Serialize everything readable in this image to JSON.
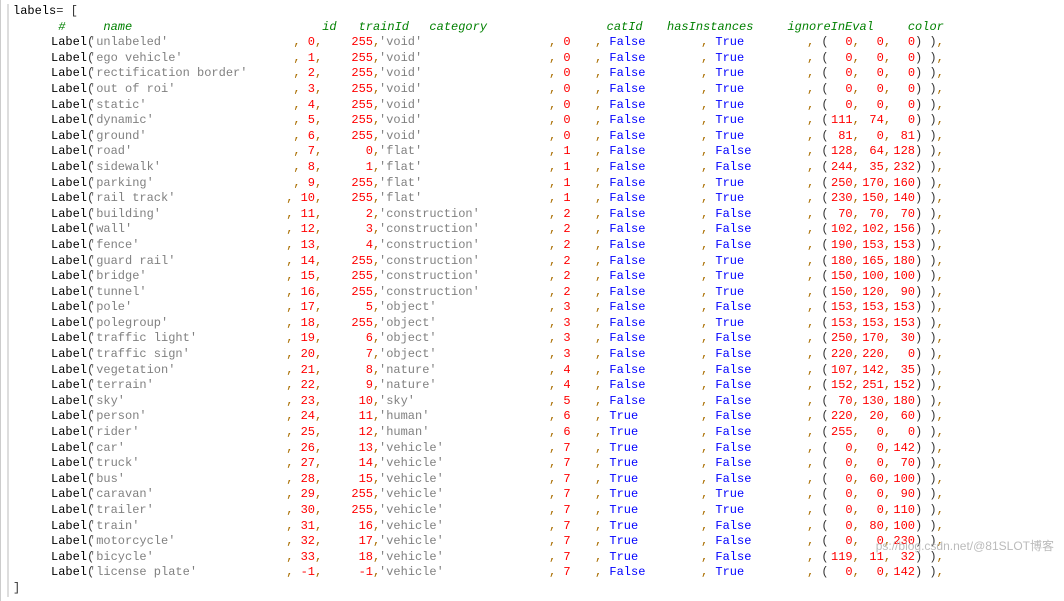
{
  "varName": "labels",
  "header": {
    "hash": "#",
    "name": "name",
    "id": "id",
    "trainId": "trainId",
    "category": "category",
    "catId": "catId",
    "hasInstances": "hasInstances",
    "ignoreInEval": "ignoreInEval",
    "color": "color"
  },
  "funcName": "Label",
  "rows": [
    {
      "name": "unlabeled",
      "id": 0,
      "trainId": 255,
      "category": "void",
      "catId": 0,
      "hasInstances": "False",
      "ignoreInEval": "True",
      "color": [
        0,
        0,
        0
      ]
    },
    {
      "name": "ego vehicle",
      "id": 1,
      "trainId": 255,
      "category": "void",
      "catId": 0,
      "hasInstances": "False",
      "ignoreInEval": "True",
      "color": [
        0,
        0,
        0
      ]
    },
    {
      "name": "rectification border",
      "id": 2,
      "trainId": 255,
      "category": "void",
      "catId": 0,
      "hasInstances": "False",
      "ignoreInEval": "True",
      "color": [
        0,
        0,
        0
      ]
    },
    {
      "name": "out of roi",
      "id": 3,
      "trainId": 255,
      "category": "void",
      "catId": 0,
      "hasInstances": "False",
      "ignoreInEval": "True",
      "color": [
        0,
        0,
        0
      ]
    },
    {
      "name": "static",
      "id": 4,
      "trainId": 255,
      "category": "void",
      "catId": 0,
      "hasInstances": "False",
      "ignoreInEval": "True",
      "color": [
        0,
        0,
        0
      ]
    },
    {
      "name": "dynamic",
      "id": 5,
      "trainId": 255,
      "category": "void",
      "catId": 0,
      "hasInstances": "False",
      "ignoreInEval": "True",
      "color": [
        111,
        74,
        0
      ]
    },
    {
      "name": "ground",
      "id": 6,
      "trainId": 255,
      "category": "void",
      "catId": 0,
      "hasInstances": "False",
      "ignoreInEval": "True",
      "color": [
        81,
        0,
        81
      ]
    },
    {
      "name": "road",
      "id": 7,
      "trainId": 0,
      "category": "flat",
      "catId": 1,
      "hasInstances": "False",
      "ignoreInEval": "False",
      "color": [
        128,
        64,
        128
      ]
    },
    {
      "name": "sidewalk",
      "id": 8,
      "trainId": 1,
      "category": "flat",
      "catId": 1,
      "hasInstances": "False",
      "ignoreInEval": "False",
      "color": [
        244,
        35,
        232
      ]
    },
    {
      "name": "parking",
      "id": 9,
      "trainId": 255,
      "category": "flat",
      "catId": 1,
      "hasInstances": "False",
      "ignoreInEval": "True",
      "color": [
        250,
        170,
        160
      ]
    },
    {
      "name": "rail track",
      "id": 10,
      "trainId": 255,
      "category": "flat",
      "catId": 1,
      "hasInstances": "False",
      "ignoreInEval": "True",
      "color": [
        230,
        150,
        140
      ]
    },
    {
      "name": "building",
      "id": 11,
      "trainId": 2,
      "category": "construction",
      "catId": 2,
      "hasInstances": "False",
      "ignoreInEval": "False",
      "color": [
        70,
        70,
        70
      ]
    },
    {
      "name": "wall",
      "id": 12,
      "trainId": 3,
      "category": "construction",
      "catId": 2,
      "hasInstances": "False",
      "ignoreInEval": "False",
      "color": [
        102,
        102,
        156
      ]
    },
    {
      "name": "fence",
      "id": 13,
      "trainId": 4,
      "category": "construction",
      "catId": 2,
      "hasInstances": "False",
      "ignoreInEval": "False",
      "color": [
        190,
        153,
        153
      ]
    },
    {
      "name": "guard rail",
      "id": 14,
      "trainId": 255,
      "category": "construction",
      "catId": 2,
      "hasInstances": "False",
      "ignoreInEval": "True",
      "color": [
        180,
        165,
        180
      ]
    },
    {
      "name": "bridge",
      "id": 15,
      "trainId": 255,
      "category": "construction",
      "catId": 2,
      "hasInstances": "False",
      "ignoreInEval": "True",
      "color": [
        150,
        100,
        100
      ]
    },
    {
      "name": "tunnel",
      "id": 16,
      "trainId": 255,
      "category": "construction",
      "catId": 2,
      "hasInstances": "False",
      "ignoreInEval": "True",
      "color": [
        150,
        120,
        90
      ]
    },
    {
      "name": "pole",
      "id": 17,
      "trainId": 5,
      "category": "object",
      "catId": 3,
      "hasInstances": "False",
      "ignoreInEval": "False",
      "color": [
        153,
        153,
        153
      ]
    },
    {
      "name": "polegroup",
      "id": 18,
      "trainId": 255,
      "category": "object",
      "catId": 3,
      "hasInstances": "False",
      "ignoreInEval": "True",
      "color": [
        153,
        153,
        153
      ]
    },
    {
      "name": "traffic light",
      "id": 19,
      "trainId": 6,
      "category": "object",
      "catId": 3,
      "hasInstances": "False",
      "ignoreInEval": "False",
      "color": [
        250,
        170,
        30
      ]
    },
    {
      "name": "traffic sign",
      "id": 20,
      "trainId": 7,
      "category": "object",
      "catId": 3,
      "hasInstances": "False",
      "ignoreInEval": "False",
      "color": [
        220,
        220,
        0
      ]
    },
    {
      "name": "vegetation",
      "id": 21,
      "trainId": 8,
      "category": "nature",
      "catId": 4,
      "hasInstances": "False",
      "ignoreInEval": "False",
      "color": [
        107,
        142,
        35
      ]
    },
    {
      "name": "terrain",
      "id": 22,
      "trainId": 9,
      "category": "nature",
      "catId": 4,
      "hasInstances": "False",
      "ignoreInEval": "False",
      "color": [
        152,
        251,
        152
      ]
    },
    {
      "name": "sky",
      "id": 23,
      "trainId": 10,
      "category": "sky",
      "catId": 5,
      "hasInstances": "False",
      "ignoreInEval": "False",
      "color": [
        70,
        130,
        180
      ]
    },
    {
      "name": "person",
      "id": 24,
      "trainId": 11,
      "category": "human",
      "catId": 6,
      "hasInstances": "True",
      "ignoreInEval": "False",
      "color": [
        220,
        20,
        60
      ]
    },
    {
      "name": "rider",
      "id": 25,
      "trainId": 12,
      "category": "human",
      "catId": 6,
      "hasInstances": "True",
      "ignoreInEval": "False",
      "color": [
        255,
        0,
        0
      ]
    },
    {
      "name": "car",
      "id": 26,
      "trainId": 13,
      "category": "vehicle",
      "catId": 7,
      "hasInstances": "True",
      "ignoreInEval": "False",
      "color": [
        0,
        0,
        142
      ]
    },
    {
      "name": "truck",
      "id": 27,
      "trainId": 14,
      "category": "vehicle",
      "catId": 7,
      "hasInstances": "True",
      "ignoreInEval": "False",
      "color": [
        0,
        0,
        70
      ]
    },
    {
      "name": "bus",
      "id": 28,
      "trainId": 15,
      "category": "vehicle",
      "catId": 7,
      "hasInstances": "True",
      "ignoreInEval": "False",
      "color": [
        0,
        60,
        100
      ]
    },
    {
      "name": "caravan",
      "id": 29,
      "trainId": 255,
      "category": "vehicle",
      "catId": 7,
      "hasInstances": "True",
      "ignoreInEval": "True",
      "color": [
        0,
        0,
        90
      ]
    },
    {
      "name": "trailer",
      "id": 30,
      "trainId": 255,
      "category": "vehicle",
      "catId": 7,
      "hasInstances": "True",
      "ignoreInEval": "True",
      "color": [
        0,
        0,
        110
      ]
    },
    {
      "name": "train",
      "id": 31,
      "trainId": 16,
      "category": "vehicle",
      "catId": 7,
      "hasInstances": "True",
      "ignoreInEval": "False",
      "color": [
        0,
        80,
        100
      ]
    },
    {
      "name": "motorcycle",
      "id": 32,
      "trainId": 17,
      "category": "vehicle",
      "catId": 7,
      "hasInstances": "True",
      "ignoreInEval": "False",
      "color": [
        0,
        0,
        230
      ]
    },
    {
      "name": "bicycle",
      "id": 33,
      "trainId": 18,
      "category": "vehicle",
      "catId": 7,
      "hasInstances": "True",
      "ignoreInEval": "False",
      "color": [
        119,
        11,
        32
      ]
    },
    {
      "name": "license plate",
      "id": -1,
      "trainId": -1,
      "category": "vehicle",
      "catId": 7,
      "hasInstances": "False",
      "ignoreInEval": "True",
      "color": [
        0,
        0,
        142
      ]
    }
  ],
  "watermark": "ps://blog.csdn.net/@81SLOT博客"
}
